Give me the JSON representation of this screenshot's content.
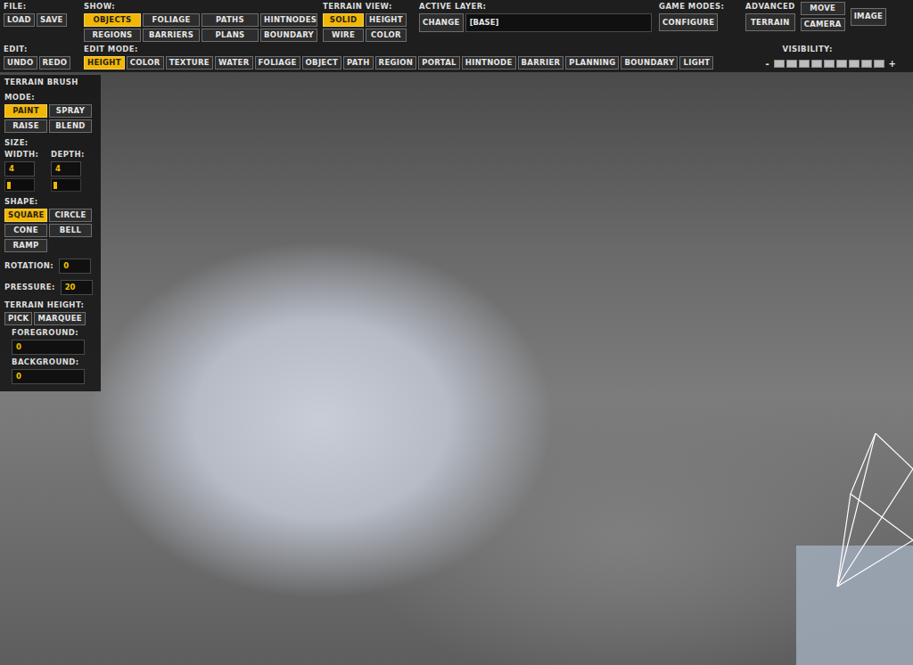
{
  "file": {
    "label": "FILE:",
    "buttons": [
      {
        "label": "LOAD",
        "selected": false
      },
      {
        "label": "SAVE",
        "selected": false
      }
    ]
  },
  "show": {
    "label": "SHOW:",
    "buttons": [
      {
        "label": "OBJECTS",
        "selected": true
      },
      {
        "label": "FOLIAGE",
        "selected": false
      },
      {
        "label": "PATHS",
        "selected": false
      },
      {
        "label": "HINTNODES",
        "selected": false
      },
      {
        "label": "REGIONS",
        "selected": false
      },
      {
        "label": "BARRIERS",
        "selected": false
      },
      {
        "label": "PLANS",
        "selected": false
      },
      {
        "label": "BOUNDARY",
        "selected": false
      }
    ]
  },
  "terrain_view": {
    "label": "TERRAIN VIEW:",
    "buttons": [
      {
        "label": "SOLID",
        "selected": true
      },
      {
        "label": "HEIGHT",
        "selected": false
      },
      {
        "label": "WIRE",
        "selected": false
      },
      {
        "label": "COLOR",
        "selected": false
      }
    ]
  },
  "active_layer": {
    "label": "ACTIVE LAYER:",
    "button": "CHANGE",
    "value": "[BASE]"
  },
  "game_modes": {
    "label": "GAME MODES:",
    "button": "CONFIGURE"
  },
  "advanced": {
    "label": "ADVANCED",
    "buttons": [
      {
        "label": "TERRAIN",
        "selected": false
      },
      {
        "label": "MOVE",
        "selected": false
      },
      {
        "label": "CAMERA",
        "selected": false
      },
      {
        "label": "IMAGE",
        "selected": false
      }
    ]
  },
  "edit": {
    "label": "EDIT:",
    "buttons": [
      {
        "label": "UNDO",
        "selected": false
      },
      {
        "label": "REDO",
        "selected": false
      }
    ]
  },
  "edit_mode": {
    "label": "EDIT MODE:",
    "buttons": [
      {
        "label": "HEIGHT",
        "selected": true
      },
      {
        "label": "COLOR",
        "selected": false
      },
      {
        "label": "TEXTURE",
        "selected": false
      },
      {
        "label": "WATER",
        "selected": false
      },
      {
        "label": "FOLIAGE",
        "selected": false
      },
      {
        "label": "OBJECT",
        "selected": false
      },
      {
        "label": "PATH",
        "selected": false
      },
      {
        "label": "REGION",
        "selected": false
      },
      {
        "label": "PORTAL",
        "selected": false
      },
      {
        "label": "HINTNODE",
        "selected": false
      },
      {
        "label": "BARRIER",
        "selected": false
      },
      {
        "label": "PLANNING",
        "selected": false
      },
      {
        "label": "BOUNDARY",
        "selected": false
      },
      {
        "label": "LIGHT",
        "selected": false
      }
    ]
  },
  "visibility": {
    "label": "VISIBILITY:",
    "minus": "-",
    "plus": "+",
    "level": 0
  },
  "terrain_brush": {
    "title": "TERRAIN BRUSH",
    "mode": {
      "label": "MODE:",
      "buttons": [
        {
          "label": "PAINT",
          "selected": true
        },
        {
          "label": "SPRAY",
          "selected": false
        },
        {
          "label": "RAISE",
          "selected": false
        },
        {
          "label": "BLEND",
          "selected": false
        }
      ]
    },
    "size": {
      "label": "SIZE:",
      "fields": [
        {
          "label": "WIDTH:",
          "value": "4",
          "level": 0.06
        },
        {
          "label": "DEPTH:",
          "value": "4",
          "level": 0.06
        }
      ]
    },
    "shape": {
      "label": "SHAPE:",
      "buttons": [
        {
          "label": "SQUARE",
          "selected": true
        },
        {
          "label": "CIRCLE",
          "selected": false
        },
        {
          "label": "CONE",
          "selected": false
        },
        {
          "label": "BELL",
          "selected": false
        },
        {
          "label": "RAMP",
          "selected": false
        }
      ]
    },
    "rotation": {
      "label": "ROTATION:",
      "value": "0"
    },
    "pressure": {
      "label": "PRESSURE:",
      "value": "20"
    },
    "terrain_height": {
      "label": "TERRAIN HEIGHT:",
      "buttons": [
        {
          "label": "PICK",
          "selected": false
        },
        {
          "label": "MARQUEE",
          "selected": false
        }
      ]
    },
    "foreground": {
      "label": "FOREGROUND:",
      "value": "0"
    },
    "background": {
      "label": "BACKGROUND:",
      "value": "0"
    }
  }
}
